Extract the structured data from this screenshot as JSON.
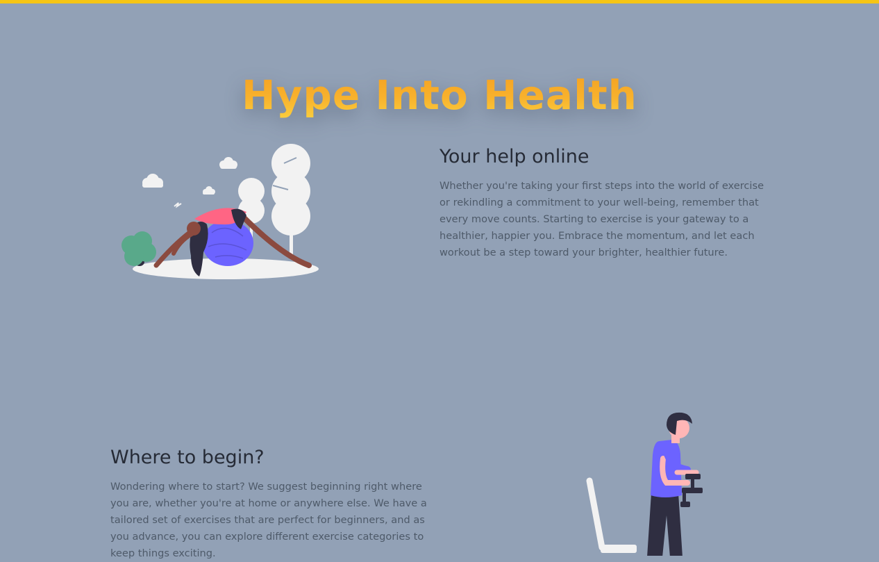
{
  "page": {
    "accent_color": "#f6c514",
    "background_color": "#92a1b6"
  },
  "hero": {
    "title": "Hype Into Health"
  },
  "sections": [
    {
      "heading": "Your help online",
      "text": "Whether you're taking your first steps into the world of exercise or rekindling a commitment to your well-being, remember that every move counts. Starting to exercise is your gateway to a healthier, happier you. Embrace the momentum, and let each workout be a step toward your brighter, healthier future.",
      "illustration": "woman-yoga-ball-illustration"
    },
    {
      "heading": "Where to begin?",
      "text": "Wondering where to start? We suggest beginning right where you are, whether you're at home or anywhere else. We have a tailored set of exercises that are perfect for beginners, and as you advance, you can explore different exercise categories to keep things exciting.",
      "illustration": "man-dumbbells-illustration"
    }
  ]
}
